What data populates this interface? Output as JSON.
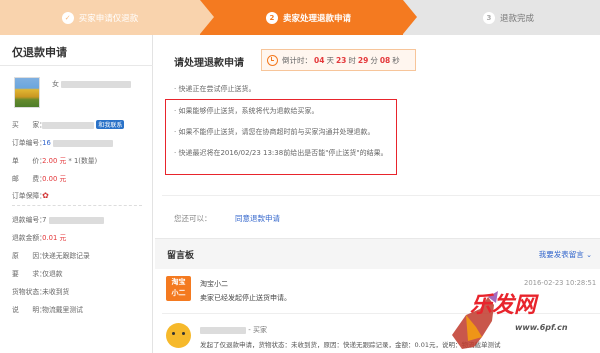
{
  "steps": [
    {
      "num": "✓",
      "label": "买家申请仅退款"
    },
    {
      "num": "2",
      "label": "卖家处理退款申请"
    },
    {
      "num": "3",
      "label": "退款完成"
    }
  ],
  "sidebar": {
    "title": "仅退款申请",
    "item_name": "女",
    "buyer_label": "买　　家：",
    "buyer_badge": "和我联系",
    "order_label": "订单编号：",
    "order_value": "16",
    "price_label": "单　　价：",
    "price_value": "2.00 元",
    "qty": " * 1(数量)",
    "ship_label": "邮　　费：",
    "ship_value": "0.00 元",
    "guarantee_label": "订单保障：",
    "refund_no_label": "退款编号：",
    "refund_no_value": "7",
    "refund_amt_label": "退款金额：",
    "refund_amt_value": "0.01 元",
    "reason_label": "原　　因：",
    "reason_value": "快递无跟踪记录",
    "require_label": "要　　求：",
    "require_value": "仅退款",
    "goods_label": "货物状态：",
    "goods_value": "未收到货",
    "desc_label": "说　　明：",
    "desc_value": "物流戴里测试"
  },
  "main": {
    "title": "请处理退款申请",
    "countdown_prefix": "倒计时：",
    "days": "04",
    "days_unit": "天",
    "hours": "23",
    "hours_unit": "时",
    "minutes": "29",
    "minutes_unit": "分",
    "seconds": "08",
    "seconds_unit": "秒",
    "notes": [
      "· 快递正在尝试停止送货。",
      "· 如果能够停止送货，系统将代为退款给买家。",
      "· 如果不能停止送货，请您在协商超时前与买家沟通并处理退款。",
      "· 快递最迟将在2016/02/23 13:38前给出是否能\"停止送货\"的结果。"
    ],
    "can_do": "您还可以：",
    "agree_link": "同意退款申请"
  },
  "messages": {
    "title": "留言板",
    "post_link": "我要发表留言",
    "items": [
      {
        "avatar": "淘宝\n小二",
        "name": "淘宝小二",
        "text": "卖家已经发起停止送货申请。",
        "time": "2016-02-23 10:28:51"
      },
      {
        "name": "- 买家",
        "text": "发起了仅退款申请，货物状态：未收到货，原因：快递无跟踪记录，金额：0.01元，说明：物流截单测试"
      }
    ]
  },
  "watermark": {
    "logo": "乐发网",
    "url": "www.6pf.cn"
  },
  "colors": {
    "accent": "#f47a20",
    "link": "#3366cc",
    "alert": "#e8242c"
  }
}
